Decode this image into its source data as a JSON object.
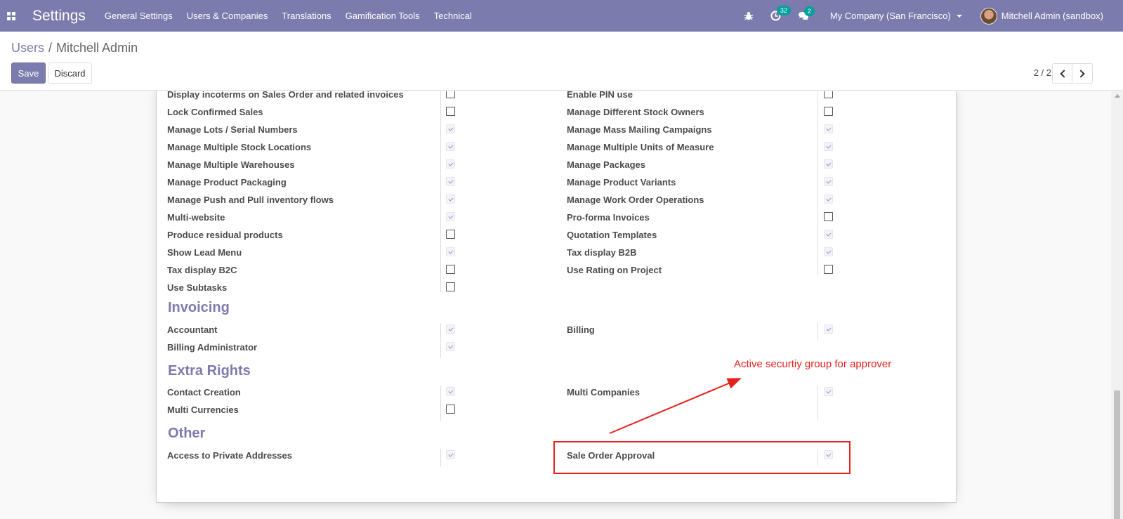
{
  "navbar": {
    "brand": "Settings",
    "menu": [
      "General Settings",
      "Users & Companies",
      "Translations",
      "Gamification Tools",
      "Technical"
    ],
    "activity_count": "32",
    "messages_count": "2",
    "company": "My Company (San Francisco)",
    "user": "Mitchell Admin (sandbox)"
  },
  "breadcrumb": {
    "parent": "Users",
    "separator": "/",
    "current": "Mitchell Admin"
  },
  "buttons": {
    "save": "Save",
    "discard": "Discard"
  },
  "pager": {
    "value": "2 / 2"
  },
  "technical_rows": [
    {
      "left": "Display incoterms on Sales Order and related invoices",
      "left_checked": false,
      "right": "Enable PIN use",
      "right_checked": false
    },
    {
      "left": "Lock Confirmed Sales",
      "left_checked": false,
      "right": "Manage Different Stock Owners",
      "right_checked": false
    },
    {
      "left": "Manage Lots / Serial Numbers",
      "left_checked": true,
      "right": "Manage Mass Mailing Campaigns",
      "right_checked": true
    },
    {
      "left": "Manage Multiple Stock Locations",
      "left_checked": true,
      "right": "Manage Multiple Units of Measure",
      "right_checked": true
    },
    {
      "left": "Manage Multiple Warehouses",
      "left_checked": true,
      "right": "Manage Packages",
      "right_checked": true
    },
    {
      "left": "Manage Product Packaging",
      "left_checked": true,
      "right": "Manage Product Variants",
      "right_checked": true
    },
    {
      "left": "Manage Push and Pull inventory flows",
      "left_checked": true,
      "right": "Manage Work Order Operations",
      "right_checked": true
    },
    {
      "left": "Multi-website",
      "left_checked": true,
      "right": "Pro-forma Invoices",
      "right_checked": false
    },
    {
      "left": "Produce residual products",
      "left_checked": false,
      "right": "Quotation Templates",
      "right_checked": true
    },
    {
      "left": "Show Lead Menu",
      "left_checked": true,
      "right": "Tax display B2B",
      "right_checked": true
    },
    {
      "left": "Tax display B2C",
      "left_checked": false,
      "right": "Use Rating on Project",
      "right_checked": false
    },
    {
      "left": "Use Subtasks",
      "left_checked": false,
      "right": null,
      "right_checked": null
    }
  ],
  "sections": {
    "invoicing": {
      "title": "Invoicing",
      "rows": [
        {
          "left": "Accountant",
          "left_checked": true,
          "right": "Billing",
          "right_checked": true
        },
        {
          "left": "Billing Administrator",
          "left_checked": true,
          "right": null,
          "right_checked": null
        }
      ]
    },
    "extra_rights": {
      "title": "Extra Rights",
      "rows": [
        {
          "left": "Contact Creation",
          "left_checked": true,
          "right": "Multi Companies",
          "right_checked": true
        },
        {
          "left": "Multi Currencies",
          "left_checked": false,
          "right": null,
          "right_checked": null
        }
      ]
    },
    "other": {
      "title": "Other",
      "rows": [
        {
          "left": "Access to Private Addresses",
          "left_checked": true,
          "right": "Sale Order Approval",
          "right_checked": true
        }
      ]
    }
  },
  "annotation": {
    "text": "Active securtiy group for approver",
    "color": "#e8201c"
  },
  "colors": {
    "brand": "#7c7bad",
    "badge": "#00a09d"
  }
}
